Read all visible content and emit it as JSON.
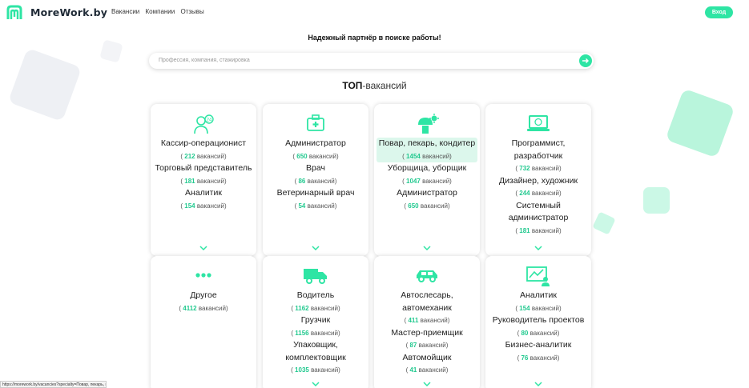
{
  "header": {
    "logo_text": "MoreWork.by",
    "nav": [
      "Вакансии",
      "Компании",
      "Отзывы"
    ],
    "login_label": "Вход"
  },
  "tagline": "Надежный партнёр в поиске работы!",
  "search": {
    "placeholder": "Профессия, компания, стажировка"
  },
  "top_title": {
    "bold": "ТОП",
    "rest": "-вакансий"
  },
  "colors": {
    "accent": "#2ee5a4",
    "count": "#22c98f"
  },
  "cards": [
    {
      "icon": "cashier-icon",
      "items": [
        {
          "name": "Кассир-операционист",
          "count": "212",
          "suffix": "вакансий"
        },
        {
          "name": "Торговый представитель",
          "count": "181",
          "suffix": "вакансий"
        },
        {
          "name": "Аналитик",
          "count": "154",
          "suffix": "вакансий"
        }
      ]
    },
    {
      "icon": "medkit-icon",
      "items": [
        {
          "name": "Администратор",
          "count": "650",
          "suffix": "вакансий"
        },
        {
          "name": "Врач",
          "count": "86",
          "suffix": "вакансий"
        },
        {
          "name": "Ветеринарный врач",
          "count": "54",
          "suffix": "вакансий"
        }
      ]
    },
    {
      "icon": "chef-icon",
      "items": [
        {
          "name": "Повар, пекарь, кондитер",
          "count": "1454",
          "suffix": "вакансий",
          "highlight": true
        },
        {
          "name": "Уборщица, уборщик",
          "count": "1047",
          "suffix": "вакансий"
        },
        {
          "name": "Администратор",
          "count": "650",
          "suffix": "вакансий"
        }
      ]
    },
    {
      "icon": "laptop-icon",
      "items": [
        {
          "name": "Программист, разработчик",
          "count": "732",
          "suffix": "вакансий"
        },
        {
          "name": "Дизайнер, художник",
          "count": "244",
          "suffix": "вакансий"
        },
        {
          "name": "Системный администратор",
          "count": "181",
          "suffix": "вакансий"
        }
      ]
    },
    {
      "icon": "more-dots-icon",
      "items": [
        {
          "name": "Другое",
          "count": "4112",
          "suffix": "вакансий"
        }
      ]
    },
    {
      "icon": "truck-icon",
      "items": [
        {
          "name": "Водитель",
          "count": "1162",
          "suffix": "вакансий"
        },
        {
          "name": "Грузчик",
          "count": "1156",
          "suffix": "вакансий"
        },
        {
          "name": "Упаковщик, комплектовщик",
          "count": "1035",
          "suffix": "вакансий"
        }
      ]
    },
    {
      "icon": "car-icon",
      "items": [
        {
          "name": "Автослесарь, автомеханик",
          "count": "411",
          "suffix": "вакансий"
        },
        {
          "name": "Мастер-приемщик",
          "count": "87",
          "suffix": "вакансий"
        },
        {
          "name": "Автомойщик",
          "count": "41",
          "suffix": "вакансий"
        }
      ]
    },
    {
      "icon": "analytics-icon",
      "items": [
        {
          "name": "Аналитик",
          "count": "154",
          "suffix": "вакансий"
        },
        {
          "name": "Руководитель проектов",
          "count": "80",
          "suffix": "вакансий"
        },
        {
          "name": "Бизнес-аналитик",
          "count": "76",
          "suffix": "вакансий"
        }
      ]
    }
  ],
  "status_bar": "https://morework.by/vacancies?specialty=Повар, пекарь, кондитер"
}
